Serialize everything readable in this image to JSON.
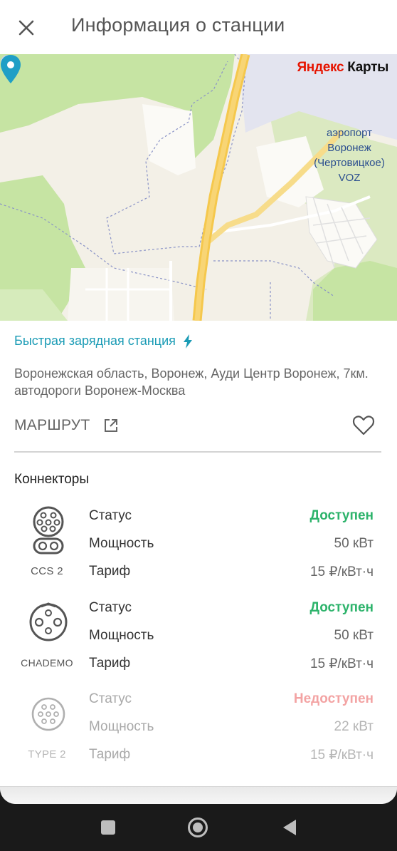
{
  "header": {
    "title": "Информация о станции",
    "close_icon": "close-icon"
  },
  "map": {
    "provider_logo_part1": "Яндекс",
    "provider_logo_part2": " Карты",
    "airport_label_lines": [
      "аэропорт",
      "Воронеж",
      "(Чертовицкое)",
      "VOZ"
    ],
    "colors": {
      "land": "#f3f0e7",
      "forest": "#c6e4a3",
      "airport": "#e3e4ef",
      "highway": "#f5c84d",
      "pin": "#1f9fc6"
    }
  },
  "station": {
    "type": "Быстрая зарядная станция",
    "type_icon": "lightning-icon",
    "address": "Воронежская область, Воронеж, Ауди Центр Воронеж, 7км. автодороги Воронеж-Москва"
  },
  "actions": {
    "route_label": "МАРШРУТ",
    "route_icon": "external-link-icon",
    "favorite_icon": "heart-outline-icon"
  },
  "connectors": {
    "title": "Коннекторы",
    "items": [
      {
        "name": "CCS 2",
        "icon": "ccs2-connector-icon",
        "status_label": "Статус",
        "status_value": "Доступен",
        "power_label": "Мощность",
        "power_value": "50 кВт",
        "tariff_label": "Тариф",
        "tariff_value": "15 ₽/кВт·ч"
      },
      {
        "name": "CHADEMO",
        "icon": "chademo-connector-icon",
        "status_label": "Статус",
        "status_value": "Доступен",
        "power_label": "Мощность",
        "power_value": "50 кВт",
        "tariff_label": "Тариф",
        "tariff_value": "15 ₽/кВт·ч"
      },
      {
        "name": "TYPE 2",
        "icon": "type2-connector-icon",
        "status_label": "Статус",
        "status_value": "Недоступен",
        "power_label": "Мощность",
        "power_value": "22 кВт",
        "tariff_label": "Тариф",
        "tariff_value": "15 ₽/кВт·ч"
      }
    ]
  },
  "system_nav": {
    "recents_icon": "square-icon",
    "home_icon": "circle-icon",
    "back_icon": "triangle-back-icon"
  },
  "colors": {
    "accent": "#1a9bb5",
    "available": "#2db36b",
    "unavailable": "#f07a7a"
  }
}
